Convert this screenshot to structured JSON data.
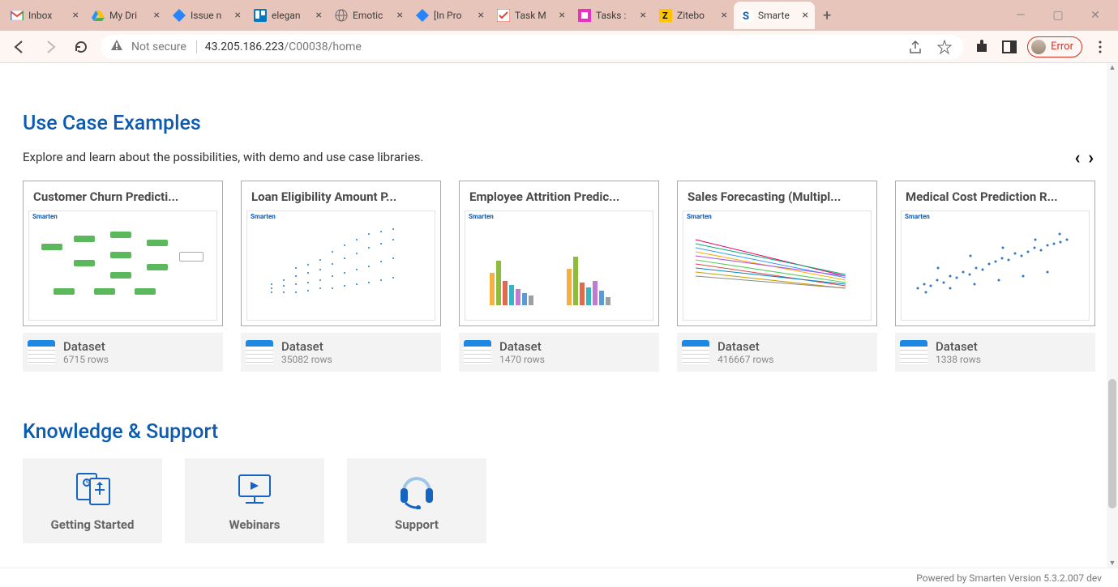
{
  "browser": {
    "tabs": [
      {
        "label": "Inbox",
        "icon": "gmail"
      },
      {
        "label": "My Dri",
        "icon": "drive"
      },
      {
        "label": "Issue n",
        "icon": "jira"
      },
      {
        "label": "elegan",
        "icon": "trello"
      },
      {
        "label": "Emotic",
        "icon": "globe"
      },
      {
        "label": "[In Pro",
        "icon": "jira"
      },
      {
        "label": "Task M",
        "icon": "todoist"
      },
      {
        "label": "Tasks :",
        "icon": "clickup"
      },
      {
        "label": "Zitebo",
        "icon": "ziteboard"
      },
      {
        "label": "Smarte",
        "icon": "smarten",
        "active": true
      }
    ],
    "not_secure": "Not secure",
    "url_host": "43.205.186.223",
    "url_path": "/C00038/home",
    "error_label": "Error"
  },
  "usecase": {
    "title": "Use Case Examples",
    "subtitle": "Explore and learn about the possibilities, with demo and use case libraries.",
    "cards": [
      {
        "title": "Customer Churn Predicti...",
        "thumb_brand": "Smarten",
        "dataset_label": "Dataset",
        "rows_label": "6715 rows"
      },
      {
        "title": "Loan Eligibility Amount P...",
        "thumb_brand": "Smarten",
        "dataset_label": "Dataset",
        "rows_label": "35082 rows"
      },
      {
        "title": "Employee Attrition Predic...",
        "thumb_brand": "Smarten",
        "dataset_label": "Dataset",
        "rows_label": "1470 rows"
      },
      {
        "title": "Sales Forecasting (Multipl...",
        "thumb_brand": "Smarten",
        "dataset_label": "Dataset",
        "rows_label": "416667 rows"
      },
      {
        "title": "Medical Cost Prediction R...",
        "thumb_brand": "Smarten",
        "dataset_label": "Dataset",
        "rows_label": "1338 rows"
      }
    ]
  },
  "knowledge": {
    "title": "Knowledge & Support",
    "items": [
      {
        "label": "Getting Started"
      },
      {
        "label": "Webinars"
      },
      {
        "label": "Support"
      }
    ]
  },
  "footer": "Powered by Smarten Version 5.3.2.007 dev"
}
